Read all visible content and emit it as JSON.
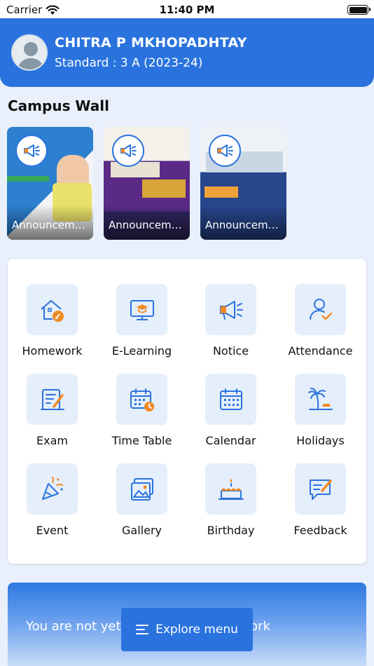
{
  "status_bar": {
    "carrier": "Carrier",
    "time": "11:40 PM"
  },
  "profile": {
    "name": "CHITRA P MKHOPADHTAY",
    "standard": "Standard : 3 A (2023-24)"
  },
  "campus_wall": {
    "title": "Campus Wall",
    "items": [
      {
        "caption": "Announcement"
      },
      {
        "caption": "Announcement"
      },
      {
        "caption": "Announcement"
      }
    ]
  },
  "modules": [
    {
      "label": "Homework",
      "icon": "homework-icon"
    },
    {
      "label": "E-Learning",
      "icon": "e-learning-icon"
    },
    {
      "label": "Notice",
      "icon": "notice-icon"
    },
    {
      "label": "Attendance",
      "icon": "attendance-icon"
    },
    {
      "label": "Exam",
      "icon": "exam-icon"
    },
    {
      "label": "Time Table",
      "icon": "time-table-icon"
    },
    {
      "label": "Calendar",
      "icon": "calendar-icon"
    },
    {
      "label": "Holidays",
      "icon": "holidays-icon"
    },
    {
      "label": "Event",
      "icon": "event-icon"
    },
    {
      "label": "Gallery",
      "icon": "gallery-icon"
    },
    {
      "label": "Birthday",
      "icon": "birthday-icon"
    },
    {
      "label": "Feedback",
      "icon": "feedback-icon"
    }
  ],
  "banner": {
    "message": "You are not yet ready to see your work"
  },
  "explore_button": {
    "label": "Explore menu"
  },
  "colors": {
    "primary": "#2a73de",
    "accent": "#f08a24",
    "background": "#e9f0fb",
    "icon_tile": "#e5eefb"
  }
}
